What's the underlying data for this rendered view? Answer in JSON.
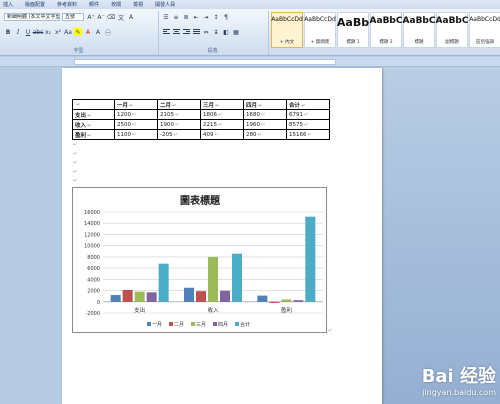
{
  "ribbon": {
    "tabs": [
      "插入",
      "版面配置",
      "參考資料",
      "郵件",
      "校閱",
      "檢視",
      "開發人員"
    ],
    "font_name": "新細明體 (本文中文字型)",
    "font_size": "五號",
    "font_group_label": "字型",
    "paragraph_group_label": "段落",
    "styles": [
      {
        "sample": "AaBbCcDd",
        "name": "+ 內文",
        "active": true
      },
      {
        "sample": "AaBbCcDd",
        "name": "+ 無間距",
        "active": false
      },
      {
        "sample": "AaBb",
        "name": "標題 1",
        "active": false
      },
      {
        "sample": "AaBbC",
        "name": "標題 2",
        "active": false
      },
      {
        "sample": "AaBbC",
        "name": "標題",
        "active": false
      },
      {
        "sample": "AaBbC",
        "name": "副標題",
        "active": false
      },
      {
        "sample": "AaBbCcDd",
        "name": "區別強調",
        "active": false
      }
    ],
    "icons": [
      "bold-icon",
      "italic-icon",
      "underline-icon",
      "strikethrough-icon",
      "subscript-icon",
      "superscript-icon",
      "highlight-icon",
      "font-color-icon",
      "align-left-icon",
      "center-icon",
      "align-right-icon",
      "justify-icon"
    ]
  },
  "table": {
    "header": [
      "",
      "一月",
      "二月",
      "三月",
      "四月",
      "合计"
    ],
    "rows": [
      [
        "支出",
        "1200",
        "2105",
        "1806",
        "1680",
        "6791"
      ],
      [
        "收入",
        "2500",
        "1900",
        "2215",
        "1960",
        "8575"
      ],
      [
        "盈利",
        "1100",
        "-205",
        "409",
        "280",
        "15166"
      ]
    ]
  },
  "chart_data": {
    "type": "bar",
    "title": "圖表標題",
    "categories": [
      "支出",
      "收入",
      "盈利"
    ],
    "series": [
      {
        "name": "一月",
        "color": "#4f81bd",
        "values": [
          1200,
          2500,
          1100
        ]
      },
      {
        "name": "二月",
        "color": "#c0504d",
        "values": [
          2105,
          1900,
          -205
        ]
      },
      {
        "name": "三月",
        "color": "#9bbb59",
        "values": [
          1806,
          8000,
          409
        ]
      },
      {
        "name": "四月",
        "color": "#8064a2",
        "values": [
          1680,
          1960,
          280
        ]
      },
      {
        "name": "合计",
        "color": "#4bacc6",
        "values": [
          6791,
          8575,
          15166
        ]
      }
    ],
    "ylim": [
      -2000,
      16000
    ],
    "yticks": [
      -2000,
      0,
      2000,
      4000,
      6000,
      8000,
      10000,
      12000,
      14000,
      16000
    ],
    "grid": true,
    "legend": "bottom"
  },
  "watermark": {
    "logo": "Bai 经验",
    "url": "jingyan.baidu.com"
  }
}
